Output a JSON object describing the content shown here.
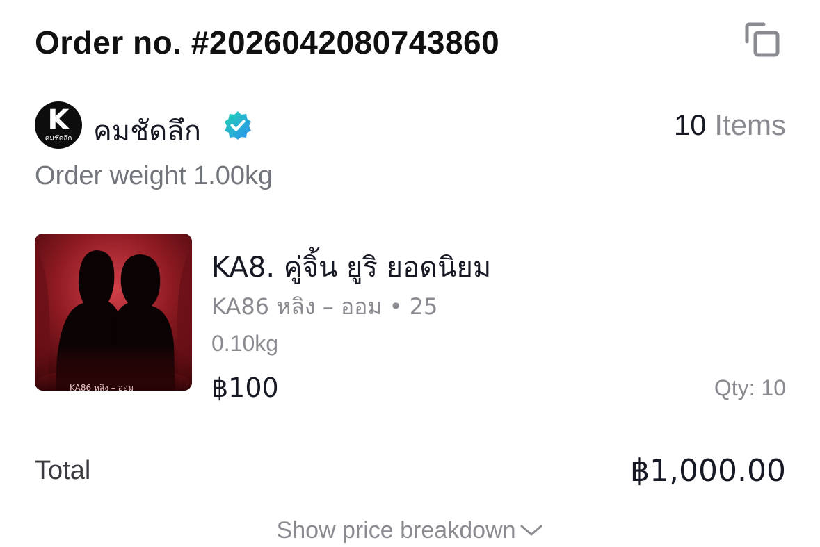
{
  "order": {
    "number_text": "Order no. #2026042080743860",
    "copy_icon": "copy-icon"
  },
  "shop": {
    "logo_letter": "K",
    "logo_subtext": "คมชัดลึก",
    "name": "คมชัดลึก",
    "verified_icon": "verified-badge-icon",
    "verified_color": "#20c4b5",
    "items_count": "10",
    "items_label": "Items"
  },
  "order_weight": "Order weight 1.00kg",
  "product": {
    "title": "KA8. คู่จิ้น ยูริ ยอดนิยม",
    "variant": "KA86 หลิง – ออม • 25",
    "weight": "0.10kg",
    "price": "฿100",
    "qty": "Qty: 10"
  },
  "total": {
    "label": "Total",
    "value": "฿1,000.00"
  },
  "breakdown": {
    "label": "Show price breakdown",
    "icon": "chevron-down-icon"
  },
  "colors": {
    "primary_text": "#161823",
    "secondary_text": "#8a8b91",
    "background": "#ffffff"
  }
}
